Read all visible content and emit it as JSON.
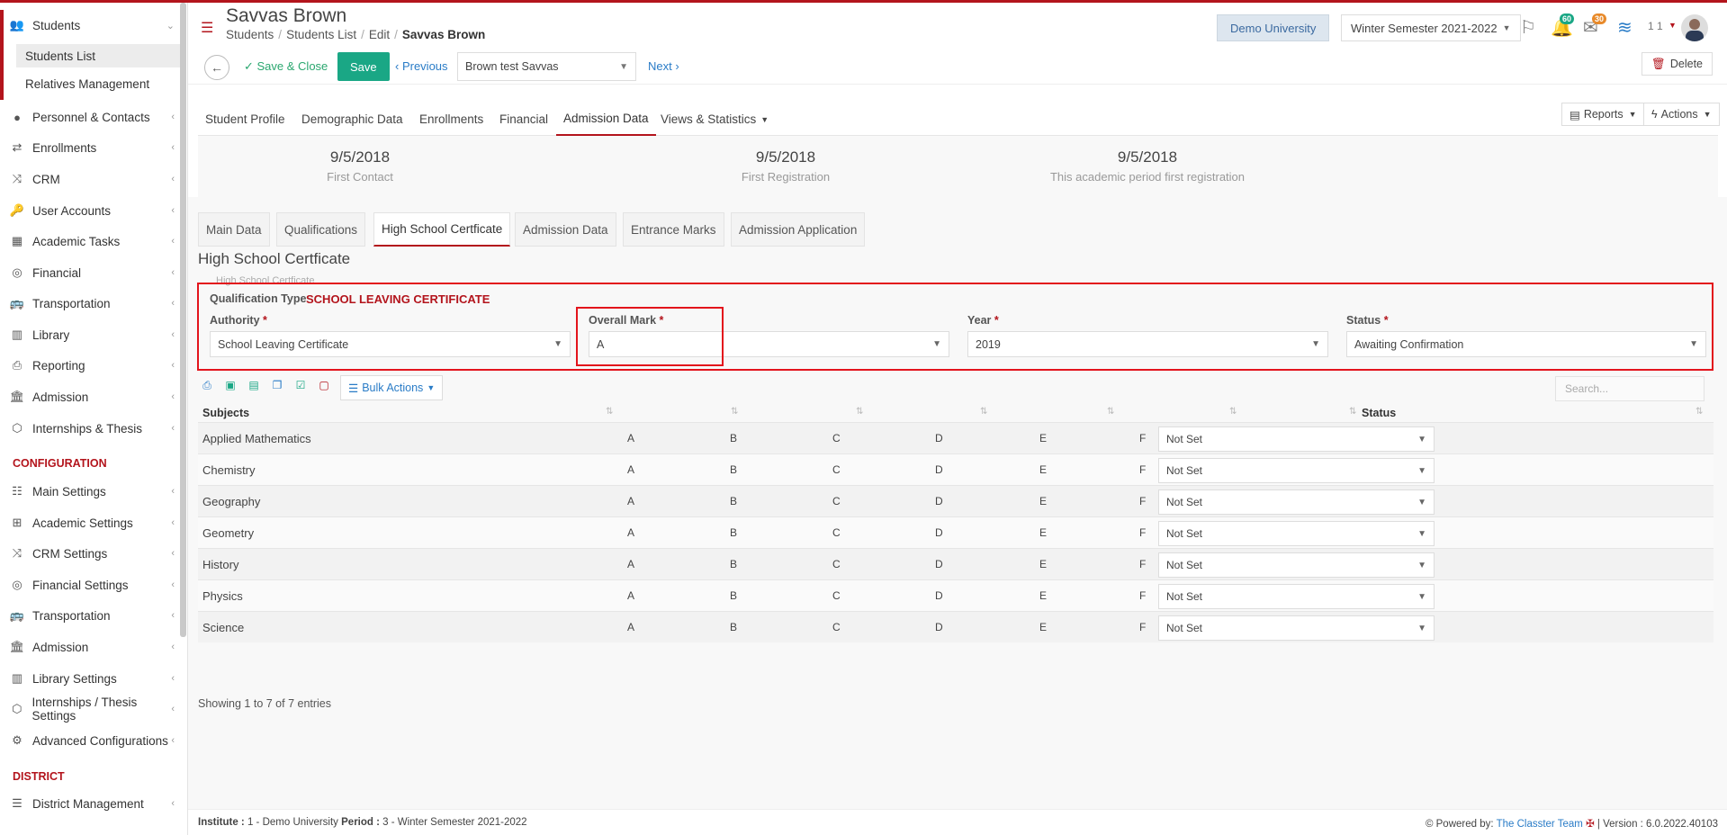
{
  "sidebar": {
    "group": {
      "label": "Students",
      "icon": "users-icon"
    },
    "subitems": [
      {
        "label": "Students List",
        "active": true
      },
      {
        "label": "Relatives Management",
        "active": false
      }
    ],
    "items": [
      {
        "label": "Personnel & Contacts",
        "icon": "person-icon"
      },
      {
        "label": "Enrollments",
        "icon": "arrows-icon"
      },
      {
        "label": "CRM",
        "icon": "shuffle-icon"
      },
      {
        "label": "User Accounts",
        "icon": "key-icon"
      },
      {
        "label": "Academic Tasks",
        "icon": "grid-icon"
      },
      {
        "label": "Financial",
        "icon": "coins-icon"
      },
      {
        "label": "Transportation",
        "icon": "bus-icon"
      },
      {
        "label": "Library",
        "icon": "books-icon"
      },
      {
        "label": "Reporting",
        "icon": "printer-icon"
      },
      {
        "label": "Admission",
        "icon": "bank-icon"
      },
      {
        "label": "Internships & Thesis",
        "icon": "cube-icon"
      }
    ],
    "config_heading": "CONFIGURATION",
    "config_items": [
      {
        "label": "Main Settings",
        "icon": "sliders-icon"
      },
      {
        "label": "Academic Settings",
        "icon": "sitemap-icon"
      },
      {
        "label": "CRM Settings",
        "icon": "shuffle-icon"
      },
      {
        "label": "Financial Settings",
        "icon": "coins-icon"
      },
      {
        "label": "Transportation",
        "icon": "bus-icon"
      },
      {
        "label": "Admission",
        "icon": "bank-icon"
      },
      {
        "label": "Library Settings",
        "icon": "books-icon"
      },
      {
        "label": "Internships / Thesis Settings",
        "icon": "cube-icon"
      },
      {
        "label": "Advanced Configurations",
        "icon": "gears-icon"
      }
    ],
    "district_heading": "DISTRICT",
    "district_items": [
      {
        "label": "District Management",
        "icon": "list-icon"
      }
    ]
  },
  "header": {
    "title": "Savvas Brown",
    "breadcrumb": [
      "Students",
      "Students List",
      "Edit",
      "Savvas Brown"
    ],
    "university": "Demo University",
    "semester": "Winter Semester 2021-2022",
    "notifications_count": "60",
    "messages_count": "30",
    "user_num": "1 1"
  },
  "toolbar": {
    "save_close": "Save & Close",
    "save": "Save",
    "previous": "Previous",
    "record": "Brown test Savvas",
    "next": "Next",
    "delete": "Delete"
  },
  "main_tabs": [
    "Student Profile",
    "Demographic Data",
    "Enrollments",
    "Financial",
    "Admission Data",
    "Views & Statistics"
  ],
  "main_tab_active": "Admission Data",
  "tab_buttons": {
    "reports": "Reports",
    "actions": "Actions"
  },
  "stats": [
    {
      "value": "9/5/2018",
      "label": "First Contact"
    },
    {
      "value": "9/5/2018",
      "label": "First Registration"
    },
    {
      "value": "9/5/2018",
      "label": "This academic period first registration"
    }
  ],
  "sub_tabs": [
    "Main Data",
    "Qualifications",
    "High School Certficate",
    "Admission Data",
    "Entrance Marks",
    "Admission Application"
  ],
  "sub_tab_active": "High School Certficate",
  "section": {
    "title": "High School Certficate",
    "ghost": "High School Certficate",
    "qualification_type_label": "Qualification Type",
    "qualification_type_value": "SCHOOL LEAVING CERTIFICATE",
    "fields": [
      {
        "label": "Authority",
        "value": "School Leaving Certificate"
      },
      {
        "label": "Overall Mark",
        "value": "A"
      },
      {
        "label": "Year",
        "value": "2019"
      },
      {
        "label": "Status",
        "value": "Awaiting Confirmation"
      }
    ]
  },
  "table": {
    "bulk_actions": "Bulk Actions",
    "search_placeholder": "Search...",
    "headers": {
      "subjects": "Subjects",
      "status": "Status"
    },
    "rows": [
      {
        "subject": "Applied Mathematics",
        "grades": [
          "A",
          "B",
          "C",
          "D",
          "E",
          "F"
        ],
        "status": "Not Set"
      },
      {
        "subject": "Chemistry",
        "grades": [
          "A",
          "B",
          "C",
          "D",
          "E",
          "F"
        ],
        "status": "Not Set"
      },
      {
        "subject": "Geography",
        "grades": [
          "A",
          "B",
          "C",
          "D",
          "E",
          "F"
        ],
        "status": "Not Set"
      },
      {
        "subject": "Geometry",
        "grades": [
          "A",
          "B",
          "C",
          "D",
          "E",
          "F"
        ],
        "status": "Not Set"
      },
      {
        "subject": "History",
        "grades": [
          "A",
          "B",
          "C",
          "D",
          "E",
          "F"
        ],
        "status": "Not Set"
      },
      {
        "subject": "Physics",
        "grades": [
          "A",
          "B",
          "C",
          "D",
          "E",
          "F"
        ],
        "status": "Not Set"
      },
      {
        "subject": "Science",
        "grades": [
          "A",
          "B",
          "C",
          "D",
          "E",
          "F"
        ],
        "status": "Not Set"
      }
    ],
    "entries": "Showing 1 to 7 of 7 entries"
  },
  "footer": {
    "institute_label": "Institute :",
    "institute_value": "1 - Demo University",
    "period_label": "Period :",
    "period_value": "3 - Winter Semester 2021-2022",
    "powered_by": "Powered by:",
    "team": "The Classter Team",
    "version": "| Version : 6.0.2022.40103"
  },
  "colors": {
    "accent": "#b3141c",
    "save": "#1aa785",
    "link": "#2a7cc7",
    "highlight": "#e3141c"
  }
}
